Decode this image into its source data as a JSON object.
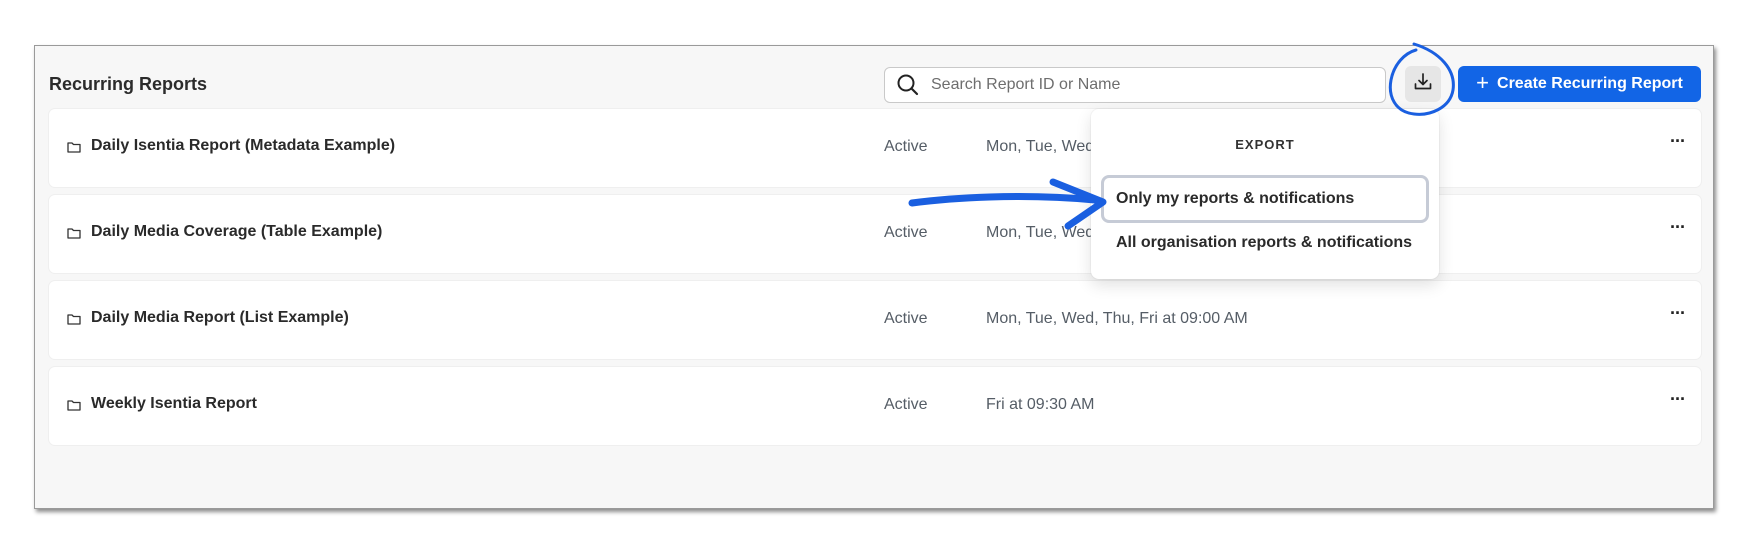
{
  "page": {
    "title": "Recurring Reports"
  },
  "search": {
    "placeholder": "Search Report ID or Name",
    "icon": "search-icon"
  },
  "toolbar": {
    "export_icon": "download-icon",
    "create_label": "Create Recurring Report",
    "create_icon": "plus-icon",
    "accent": "#1265e6"
  },
  "reports": [
    {
      "name": "Daily Isentia Report (Metadata Example)",
      "status": "Active",
      "schedule": "Mon, Tue, Wed"
    },
    {
      "name": "Daily Media Coverage (Table Example)",
      "status": "Active",
      "schedule": "Mon, Tue, Wed"
    },
    {
      "name": "Daily Media Report (List Example)",
      "status": "Active",
      "schedule": "Mon, Tue, Wed, Thu, Fri at 09:00 AM"
    },
    {
      "name": "Weekly Isentia Report",
      "status": "Active",
      "schedule": "Fri at 09:30 AM"
    }
  ],
  "row_menu_label": "···",
  "export_menu": {
    "heading": "EXPORT",
    "options": [
      {
        "label": "Only my reports & notifications",
        "selected": true
      },
      {
        "label": "All organisation reports & notifications",
        "selected": false
      }
    ]
  },
  "annotation_color": "#1a5fe0"
}
